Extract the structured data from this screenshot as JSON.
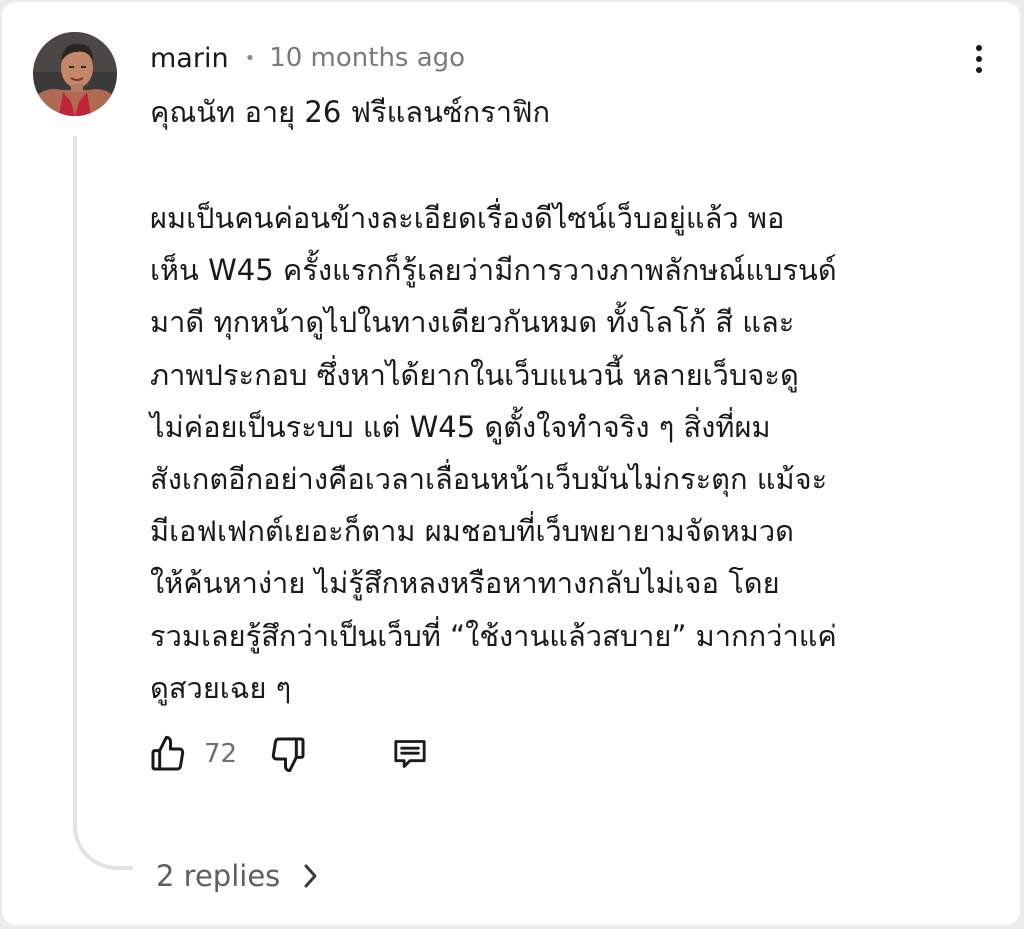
{
  "comment": {
    "author": "marin",
    "separator": "•",
    "timestamp": "10 months ago",
    "title": "คุณนัท อายุ 26 ฟรีแลนซ์กราฟิก",
    "body_lines": [
      "ผมเป็นคนค่อนข้างละเอียดเรื่องดีไซน์เว็บอยู่แล้ว พอ",
      "เห็น W45 ครั้งแรกก็รู้เลยว่ามีการวางภาพลักษณ์แบรนด์",
      "มาดี ทุกหน้าดูไปในทางเดียวกันหมด ทั้งโลโก้ สี และ",
      "ภาพประกอบ ซึ่งหาได้ยากในเว็บแนวนี้ หลายเว็บจะดู",
      "ไม่ค่อยเป็นระบบ แต่ W45 ดูตั้งใจทำจริง ๆ สิ่งที่ผม",
      "สังเกตอีกอย่างคือเวลาเลื่อนหน้าเว็บมันไม่กระตุก แม้จะ",
      "มีเอฟเฟกต์เยอะก็ตาม ผมชอบที่เว็บพยายามจัดหมวด",
      "ให้ค้นหาง่าย ไม่รู้สึกหลงหรือหาทางกลับไม่เจอ โดย",
      "รวมเลยรู้สึกว่าเป็นเว็บที่ “ใช้งานแล้วสบาย” มากกว่าแค่",
      "ดูสวยเฉย ๆ"
    ],
    "like_count": "72",
    "replies_label": "2 replies"
  },
  "icons": {
    "avatar": "avatar-photo",
    "menu": "more-vert-icon",
    "like": "thumbs-up-icon",
    "dislike": "thumbs-down-icon",
    "reply": "comment-icon",
    "chevron": "chevron-right-icon"
  },
  "colors": {
    "text_primary": "#1a1a1a",
    "text_secondary": "#7a7a7a",
    "thread_line": "#e3e3e3",
    "background": "#ffffff"
  }
}
